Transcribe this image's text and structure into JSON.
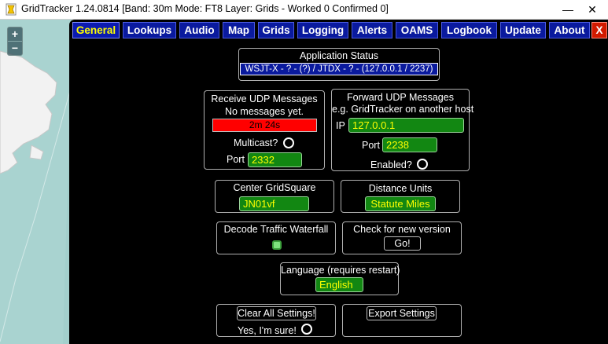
{
  "window": {
    "title": "GridTracker 1.24.0814 [Band: 30m Mode: FT8 Layer: Grids - Worked 0 Confirmed 0]",
    "minimize_glyph": "—",
    "close_glyph": "✕"
  },
  "map": {
    "zoom_in": "+",
    "zoom_out": "−"
  },
  "tabs": [
    {
      "label": "General",
      "active": true
    },
    {
      "label": "Lookups"
    },
    {
      "label": "Audio"
    },
    {
      "label": "Map"
    },
    {
      "label": "Grids"
    },
    {
      "label": "Logging"
    },
    {
      "label": "Alerts"
    },
    {
      "label": "OAMS"
    },
    {
      "label": "Logbook"
    },
    {
      "label": "Update"
    },
    {
      "label": "About"
    },
    {
      "label": "X"
    }
  ],
  "app_status": {
    "title": "Application Status",
    "value": "WSJT-X - ? - (?) / JTDX - ? - (127.0.0.1 / 2237)"
  },
  "receive_udp": {
    "title": "Receive UDP Messages",
    "status": "No messages yet.",
    "timer": "2m 24s",
    "multicast_label": "Multicast?",
    "port_label": "Port",
    "port": "2332"
  },
  "forward_udp": {
    "title": "Forward UDP Messages",
    "subtitle": "e.g. GridTracker on another host",
    "ip_label": "IP",
    "ip": "127.0.0.1",
    "port_label": "Port",
    "port": "2238",
    "enabled_label": "Enabled?"
  },
  "center_grid": {
    "title": "Center GridSquare",
    "value": "JN01vf"
  },
  "distance_units": {
    "title": "Distance Units",
    "value": "Statute Miles"
  },
  "decode_waterfall": {
    "title": "Decode Traffic Waterfall",
    "checked": true
  },
  "check_version": {
    "title": "Check for new version",
    "button": "Go!"
  },
  "language": {
    "title": "Language (requires restart)",
    "value": "English"
  },
  "clear_settings": {
    "button": "Clear All Settings!",
    "confirm_label": "Yes, I'm sure!"
  },
  "export_settings": {
    "button": "Export Settings"
  },
  "colors": {
    "tab_bg": "#0a1a9e",
    "accent_yellow": "#ffff00",
    "green": "#128712",
    "red": "#ff0000"
  }
}
